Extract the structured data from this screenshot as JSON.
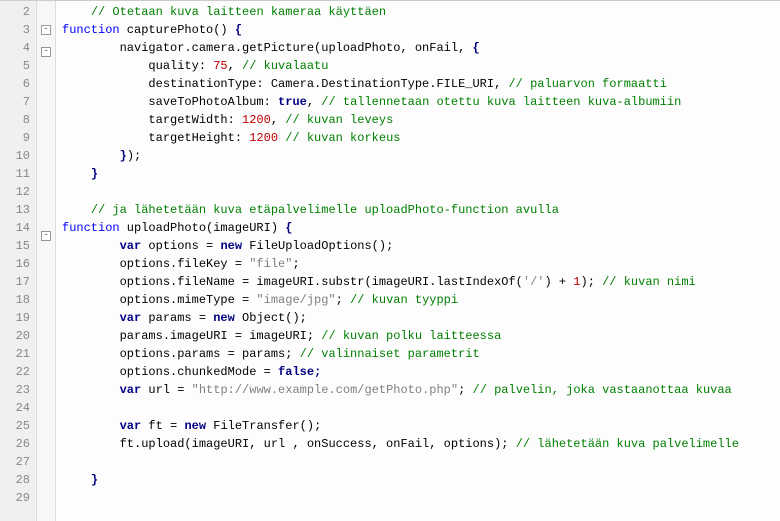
{
  "lines": [
    {
      "n": 2,
      "fold": "",
      "tokens": [
        {
          "t": "    "
        },
        {
          "t": "// Otetaan kuva laitteen kameraa käyttäen",
          "c": "cmt"
        }
      ]
    },
    {
      "n": 3,
      "fold": "-",
      "tokens": [
        {
          "t": "function",
          "c": "kw"
        },
        {
          "t": " capturePhoto() "
        },
        {
          "t": "{",
          "c": "op"
        }
      ]
    },
    {
      "n": 4,
      "fold": "-",
      "tokens": [
        {
          "t": "        navigator.camera.getPicture(uploadPhoto, onFail, "
        },
        {
          "t": "{",
          "c": "op"
        }
      ]
    },
    {
      "n": 5,
      "fold": "",
      "tokens": [
        {
          "t": "            quality: "
        },
        {
          "t": "75",
          "c": "num"
        },
        {
          "t": ", "
        },
        {
          "t": "// kuvalaatu",
          "c": "cmt"
        }
      ]
    },
    {
      "n": 6,
      "fold": "",
      "tokens": [
        {
          "t": "            destinationType: Camera.DestinationType.FILE_URI, "
        },
        {
          "t": "// paluarvon formaatti",
          "c": "cmt"
        }
      ]
    },
    {
      "n": 7,
      "fold": "",
      "tokens": [
        {
          "t": "            saveToPhotoAlbum: "
        },
        {
          "t": "true",
          "c": "kw2"
        },
        {
          "t": ", "
        },
        {
          "t": "// tallennetaan otettu kuva laitteen kuva-albumiin",
          "c": "cmt"
        }
      ]
    },
    {
      "n": 8,
      "fold": "",
      "tokens": [
        {
          "t": "            targetWidth: "
        },
        {
          "t": "1200",
          "c": "num"
        },
        {
          "t": ", "
        },
        {
          "t": "// kuvan leveys",
          "c": "cmt"
        }
      ]
    },
    {
      "n": 9,
      "fold": "",
      "tokens": [
        {
          "t": "            targetHeight: "
        },
        {
          "t": "1200",
          "c": "num"
        },
        {
          "t": " "
        },
        {
          "t": "// kuvan korkeus",
          "c": "cmt"
        }
      ]
    },
    {
      "n": 10,
      "fold": "",
      "tokens": [
        {
          "t": "        "
        },
        {
          "t": "}",
          "c": "op"
        },
        {
          "t": ");"
        }
      ]
    },
    {
      "n": 11,
      "fold": "",
      "tokens": [
        {
          "t": "    "
        },
        {
          "t": "}",
          "c": "op"
        }
      ]
    },
    {
      "n": 12,
      "fold": "",
      "tokens": [
        {
          "t": ""
        }
      ]
    },
    {
      "n": 13,
      "fold": "",
      "tokens": [
        {
          "t": "    "
        },
        {
          "t": "// ja lähetetään kuva etäpalvelimelle uploadPhoto-function avulla",
          "c": "cmt"
        }
      ]
    },
    {
      "n": 14,
      "fold": "-",
      "tokens": [
        {
          "t": "function",
          "c": "kw"
        },
        {
          "t": " uploadPhoto(imageURI) "
        },
        {
          "t": "{",
          "c": "op"
        }
      ]
    },
    {
      "n": 15,
      "fold": "",
      "tokens": [
        {
          "t": "        "
        },
        {
          "t": "var",
          "c": "kw2"
        },
        {
          "t": " options = "
        },
        {
          "t": "new",
          "c": "kw2"
        },
        {
          "t": " FileUploadOptions();"
        }
      ]
    },
    {
      "n": 16,
      "fold": "",
      "tokens": [
        {
          "t": "        options.fileKey = "
        },
        {
          "t": "\"file\"",
          "c": "str"
        },
        {
          "t": ";"
        }
      ]
    },
    {
      "n": 17,
      "fold": "",
      "tokens": [
        {
          "t": "        options.fileName = imageURI.substr(imageURI.lastIndexOf("
        },
        {
          "t": "'/'",
          "c": "str"
        },
        {
          "t": ") + "
        },
        {
          "t": "1",
          "c": "num"
        },
        {
          "t": "); "
        },
        {
          "t": "// kuvan nimi",
          "c": "cmt"
        }
      ]
    },
    {
      "n": 18,
      "fold": "",
      "tokens": [
        {
          "t": "        options.mimeType = "
        },
        {
          "t": "\"image/jpg\"",
          "c": "str"
        },
        {
          "t": "; "
        },
        {
          "t": "// kuvan tyyppi",
          "c": "cmt"
        }
      ]
    },
    {
      "n": 19,
      "fold": "",
      "tokens": [
        {
          "t": "        "
        },
        {
          "t": "var",
          "c": "kw2"
        },
        {
          "t": " params = "
        },
        {
          "t": "new",
          "c": "kw2"
        },
        {
          "t": " Object();"
        }
      ]
    },
    {
      "n": 20,
      "fold": "",
      "tokens": [
        {
          "t": "        params.imageURI = imageURI; "
        },
        {
          "t": "// kuvan polku laitteessa",
          "c": "cmt"
        }
      ]
    },
    {
      "n": 21,
      "fold": "",
      "tokens": [
        {
          "t": "        options.params = params; "
        },
        {
          "t": "// valinnaiset parametrit",
          "c": "cmt"
        }
      ]
    },
    {
      "n": 22,
      "fold": "",
      "tokens": [
        {
          "t": "        options.chunkedMode = "
        },
        {
          "t": "false",
          "c": "kw2"
        },
        {
          "t": ";",
          "c": "kw2"
        }
      ]
    },
    {
      "n": 23,
      "fold": "",
      "tokens": [
        {
          "t": "        "
        },
        {
          "t": "var",
          "c": "kw2"
        },
        {
          "t": " url = "
        },
        {
          "t": "\"http://www.example.com/getPhoto.php\"",
          "c": "str"
        },
        {
          "t": "; "
        },
        {
          "t": "// palvelin, joka vastaanottaa kuvaa",
          "c": "cmt"
        }
      ]
    },
    {
      "n": 24,
      "fold": "",
      "tokens": [
        {
          "t": ""
        }
      ]
    },
    {
      "n": 25,
      "fold": "",
      "tokens": [
        {
          "t": "        "
        },
        {
          "t": "var",
          "c": "kw2"
        },
        {
          "t": " ft = "
        },
        {
          "t": "new",
          "c": "kw2"
        },
        {
          "t": " FileTransfer();"
        }
      ]
    },
    {
      "n": 26,
      "fold": "",
      "tokens": [
        {
          "t": "        ft.upload(imageURI, url , onSuccess, onFail, options); "
        },
        {
          "t": "// lähetetään kuva palvelimelle",
          "c": "cmt"
        }
      ]
    },
    {
      "n": 27,
      "fold": "",
      "tokens": [
        {
          "t": ""
        }
      ]
    },
    {
      "n": 28,
      "fold": "",
      "tokens": [
        {
          "t": "    "
        },
        {
          "t": "}",
          "c": "op"
        }
      ]
    },
    {
      "n": 29,
      "fold": "",
      "tokens": [
        {
          "t": ""
        }
      ]
    }
  ]
}
